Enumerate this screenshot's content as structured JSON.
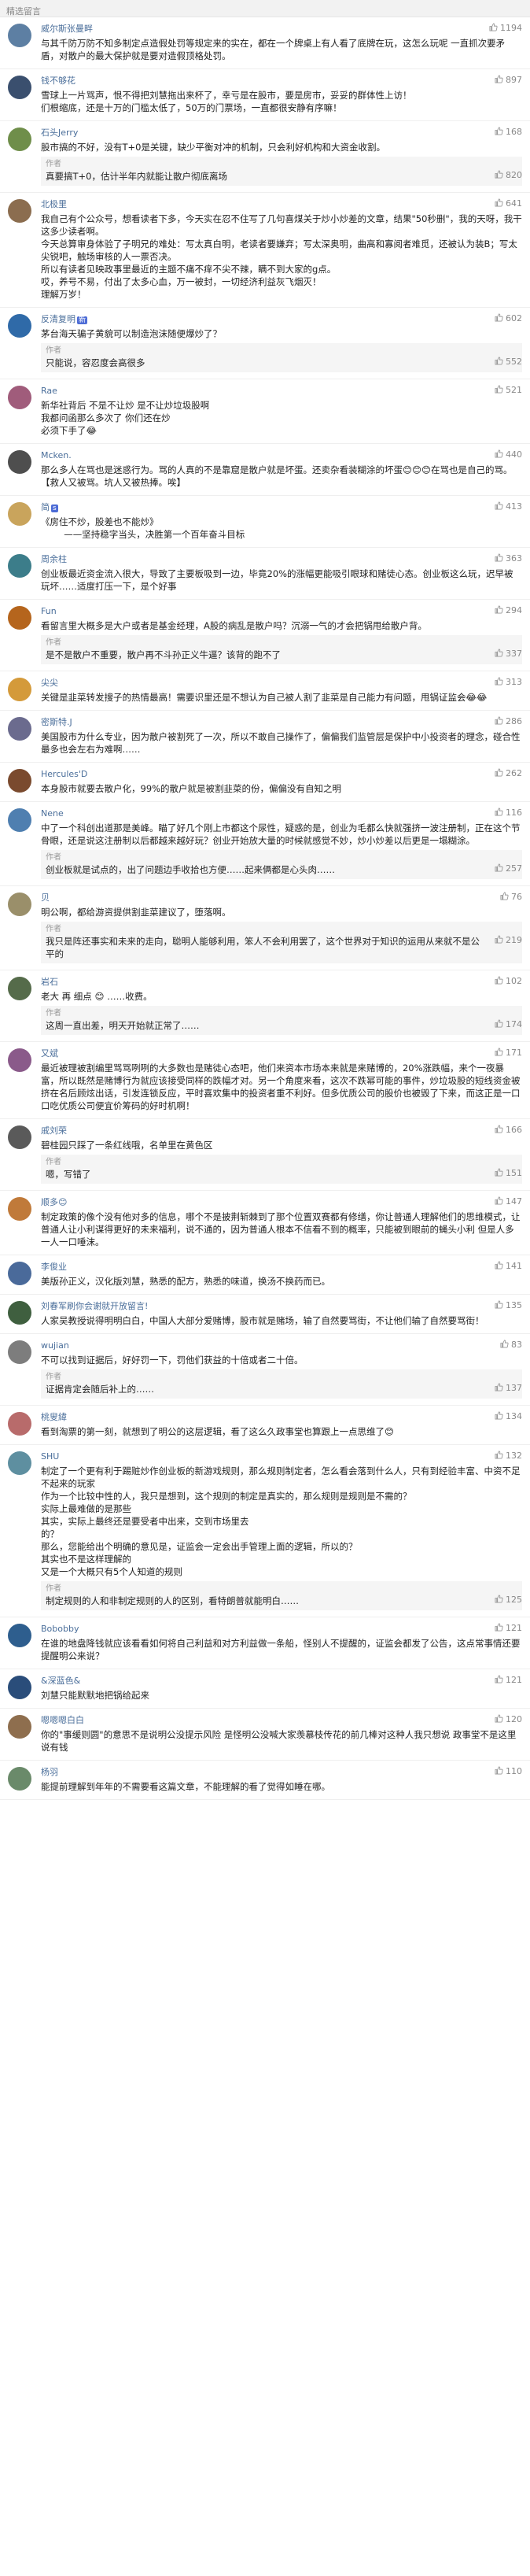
{
  "header": {
    "title": "精选留言"
  },
  "comments": [
    {
      "user": "威尔斯张曼畔",
      "likes": "1194",
      "avatar_color": "#5d7fa3",
      "text": "与其千防万防不知多制定点造假处罚等规定来的实在，都在一个牌桌上有人看了底牌在玩，这怎么玩呢 一直抓次要矛盾，对散户的最大保护就是要对造假顶格处罚。",
      "replies": []
    },
    {
      "user": "钱不够花",
      "likes": "897",
      "avatar_color": "#3a4f6e",
      "text": "雪球上一片骂声，恨不得把刘慧拖出来杯了，幸亏是在股市，要是房市，妥妥的群体性上访！\n们根缩底，还是十万的门槛太低了，50万的门票场，一直都很安静有序嘛！",
      "replies": []
    },
    {
      "user": "石头Jerry",
      "likes": "168",
      "avatar_color": "#6f8e4a",
      "text": "股市搞的不好，没有T+0是关键，缺少平衡对冲的机制，只会利好机构和大资金收割。",
      "replies": [
        {
          "who": "作者",
          "likes": "820",
          "text": "真要搞T+0，估计半年内就能让散户彻底离场"
        }
      ]
    },
    {
      "user": "北极里",
      "likes": "641",
      "avatar_color": "#8b6d4f",
      "text": "我自己有个公众号，想看读者下多，今天实在忍不住写了几句喜煤关于炒小炒差的文章，结果\"50秒删\"，我的天呀，我干这多少读者啊。\n今天总算审身体验了子明兄的难处：写太真白明，老读者要嫌弃；写太深奥明，曲高和寡阅者难觅，还被认为装B；写太尖锐吧，触场审核的人一票否决。\n所以有读者见映政事里最近的主题不痛不痒不尖不辣，瞒不到大家的g点。\n哎，养号不易，付出了太多心血，万一被封，一切经济利益灰飞烟灭！\n理解万岁！",
      "replies": []
    },
    {
      "user": "反清复明",
      "tag": "新",
      "likes": "602",
      "avatar_color": "#2f6aa8",
      "text": "茅台海天骗子黄貌可以制造泡沫随便爆炒了？",
      "replies": [
        {
          "who": "作者",
          "likes": "552",
          "text": "只能说，容忍度会高很多"
        }
      ]
    },
    {
      "user": "Rae",
      "likes": "521",
      "avatar_color": "#a05c7b",
      "text": "新华社背后 不是不让炒 是不让炒垃圾股啊\n我都问函那么多次了 你们还在炒\n必须下手了😂",
      "replies": []
    },
    {
      "user": "Mcken.",
      "likes": "440",
      "avatar_color": "#4e4e4e",
      "text": "那么多人在骂也是迷惑行为。骂的人真的不是靠窟是散户就是坏蛋。还卖杂看装糊涂的坏蛋😊😊😊在骂也是自己的骂。\n【救人又被骂。坑人又被热捧。唉】",
      "replies": []
    },
    {
      "user": "简",
      "tag": "s",
      "likes": "413",
      "avatar_color": "#c9a45c",
      "text": "《房住不炒，股差也不能炒》\n        ——坚持稳字当头，决胜第一个百年奋斗目标",
      "replies": []
    },
    {
      "user": "周余柱",
      "likes": "363",
      "avatar_color": "#3c7d8a",
      "text": "创业板最近资金流入很大，导致了主要板吸到一边，毕竟20%的涨幅更能吸引眼球和赌徒心态。创业板这么玩，迟早被玩坏……适度打压一下，是个好事",
      "replies": []
    },
    {
      "user": "Fun",
      "likes": "294",
      "avatar_color": "#b5651d",
      "text": "看留言里大概多是大户或者是基金经理，A股的病乱是散户吗？沉溺一气的才会把锅甩给散户背。",
      "replies": [
        {
          "who": "作者",
          "likes": "337",
          "text": "是不是散户不重要，散户再不斗孙正义牛逼？该背的跑不了"
        }
      ]
    },
    {
      "user": "尖尖",
      "likes": "313",
      "avatar_color": "#d49a3a",
      "text": "关键是韭菜转发搜子的热情最高！需要识里还是不想认为自己被人割了韭菜是自己能力有问题，甩锅证监会😂😂",
      "replies": []
    },
    {
      "user": "密斯特.J",
      "likes": "286",
      "avatar_color": "#6b6b8e",
      "text": "美国股市为什么专业，因为散户被割死了一次，所以不敢自己操作了，偏偏我们监管层是保护中小投资者的理念，碰合性最多也会左右为难啊……",
      "replies": []
    },
    {
      "user": "Hercules'D",
      "likes": "262",
      "avatar_color": "#7a4a2e",
      "text": "本身股市就要去散户化，99%的散户就是被割韭菜的份，偏偏没有自知之明",
      "replies": []
    },
    {
      "user": "Nene",
      "likes": "116",
      "avatar_color": "#4f7fb0",
      "text": "中了一个科创出道那是美峰。瞄了好几个刚上市都这个尿性，疑惑的是，创业为毛都么快就强挤一波注册制，正在这个节骨眼，还是说这注册制以后都越来越好玩？创业开始放大量的时候就感觉不妙，炒小炒差以后更是一塌糊涂。",
      "replies": [
        {
          "who": "作者",
          "likes": "257",
          "text": "创业板就是试点的，出了问题边手收拾也方便……起来俩都是心头肉……"
        }
      ]
    },
    {
      "user": "贝",
      "likes": "76",
      "avatar_color": "#9a8f6a",
      "text": "明公啊，都给游资提供割韭菜建议了，堕落啊。",
      "replies": [
        {
          "who": "作者",
          "likes": "219",
          "text": "我只是阵还事实和未来的走向，聪明人能够利用，笨人不会利用罢了，这个世界对于知识的运用从来就不是公平的"
        }
      ]
    },
    {
      "user": "岩石",
      "likes": "102",
      "avatar_color": "#556b4a",
      "text": "老大 再 细点 😊 ……收费。",
      "replies": [
        {
          "who": "作者",
          "likes": "174",
          "text": "这周一直出差，明天开始就正常了……"
        }
      ]
    },
    {
      "user": "又斌",
      "likes": "171",
      "avatar_color": "#8a5a8a",
      "text": "最近被理被割编里骂骂咧咧的大多数也是赌徒心态吧，他们来资本市场本来就是来赌博的，20%涨跌幅，来个一夜暴富，所以既然是赌博行为就应该接受同样的跌幅才对。另一个角度来看，这次不跌幂可能的事件，炒垃圾股的短线资金被挤在名后顾炫出话，引发连锁反应，平时喜欢集中的投资者重不利好。但多优质公司的股价也被毁了下来，而这正是一口口吃优质公司便宜价筹码的好时机啊！",
      "replies": []
    },
    {
      "user": "戚刘荣",
      "likes": "166",
      "avatar_color": "#5a5a5a",
      "text": "碧桂园只踩了一条红线哦，名单里在黄色区",
      "replies": [
        {
          "who": "作者",
          "likes": "151",
          "text": "嗯，写错了"
        }
      ]
    },
    {
      "user": "顺多😊",
      "likes": "147",
      "avatar_color": "#c07a3a",
      "text": "制定政策的像个没有他对多的信息，哪个不是披荆斩棘到了那个位置双赛都有修缮，你让普通人理解他们的思维模式，让普通人让小利谋得更好的未来福利，说不通的，因为普通人根本不信看不到的概率，只能被到眼前的蝇头小利 但是人多一人一口唾沫。",
      "replies": []
    },
    {
      "user": "李俊业",
      "likes": "141",
      "avatar_color": "#4a6a9a",
      "text": "美版孙正义，汉化版刘慧，熟悉的配方，熟悉的味道，换汤不换药而已。",
      "replies": []
    },
    {
      "user": "刘春军刷你会谢就开放留言!",
      "likes": "135",
      "avatar_color": "#3f5f3f",
      "text": "人家吴教授说得明明白白，中国人大部分爱赌博，股市就是赌场，输了自然要骂街，不让他们输了自然要骂街！",
      "replies": []
    },
    {
      "user": "wujian",
      "likes": "83",
      "avatar_color": "#7d7d7d",
      "text": "不可以找到证据后，好好罚一下，罚他们获益的十倍或者二十倍。",
      "replies": [
        {
          "who": "作者",
          "likes": "137",
          "text": "证据肯定会随后补上的……"
        }
      ]
    },
    {
      "user": "桃叟緯",
      "likes": "134",
      "avatar_color": "#b86b6b",
      "text": "看到淘票的第一刻，就想到了明公的这层逻辑，看了这么久政事堂也算跟上一点思维了😊",
      "replies": []
    },
    {
      "user": "SHU",
      "likes": "132",
      "avatar_color": "#5e8fa0",
      "text": "制定了一个更有利于踢赃炒作创业板的新游戏规则，那么规则制定者，怎么看会落到什么人，只有到经验丰富、中资不足不起来的玩家\n作为一个比较中性的人，我只是想到，这个规则的制定是真实的，那么规则是规则是不需的？\n实际上最难做的是那些\n其实，实际上最终还是要受者中出来，交到市场里去\n的？\n那么，您能给出个明确的意见是，证监会一定会出手管理上面的逻辑，所以的？\n其实也不是这样理解的\n又是一个大概只有5个人知道的规则",
      "replies": [
        {
          "who": "作者",
          "likes": "125",
          "text": "制定规则的人和非制定规则的人的区别，看特朗普就能明白……"
        }
      ]
    },
    {
      "user": "Bobobby",
      "likes": "121",
      "avatar_color": "#2e5e8e",
      "text": "在谁的地盘降钱就应该看看如何将自己利益和对方利益做一条船，怪别人不提醒的，证监会都发了公告，这点常事情还要提醒明公来说？",
      "replies": []
    },
    {
      "user": "&深蓝色&",
      "likes": "121",
      "avatar_color": "#2a4d7a",
      "text": "刘慧只能默默地把锅给起来",
      "replies": []
    },
    {
      "user": "嗯嗯嗯白白",
      "likes": "120",
      "avatar_color": "#8e6e4e",
      "text": "你的\"事缓则圆\"的意思不是说明公没提示风险 是怪明公没喊大家羡慕枝传花的前几棒对这种人我只想说 政事堂不是这里说有钱",
      "replies": []
    },
    {
      "user": "杨羽",
      "likes": "110",
      "avatar_color": "#6a8a6a",
      "text": "能提前理解到年年的不需要看这篇文章，不能理解的看了觉得如睡在哪。",
      "replies": []
    }
  ]
}
